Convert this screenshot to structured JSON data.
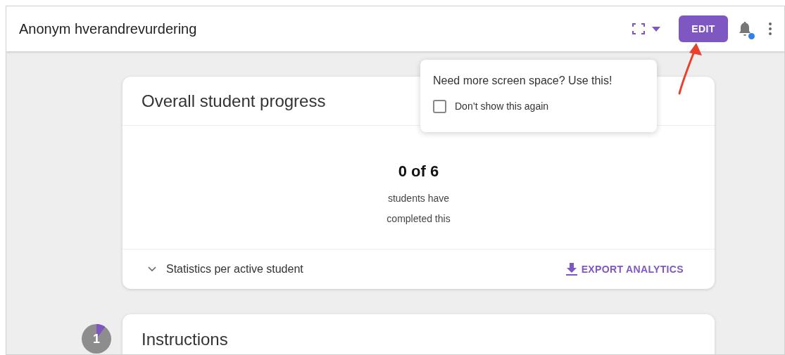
{
  "header": {
    "title": "Anonym hverandrevurdering",
    "edit_button": "EDIT",
    "notification_dot": true
  },
  "tooltip": {
    "message": "Need more screen space? Use this!",
    "checkbox": {
      "label": "Don’t show this again",
      "checked": false
    }
  },
  "progress_card": {
    "title": "Overall student progress",
    "count": "0 of 6",
    "caption_lines": [
      "students have",
      "completed this"
    ],
    "statistics_toggle": {
      "label": "Statistics per active student",
      "expanded": false
    },
    "export_button": "EXPORT ANALYTICS"
  },
  "sections": [
    {
      "number": "1",
      "title": "Instructions"
    }
  ]
}
